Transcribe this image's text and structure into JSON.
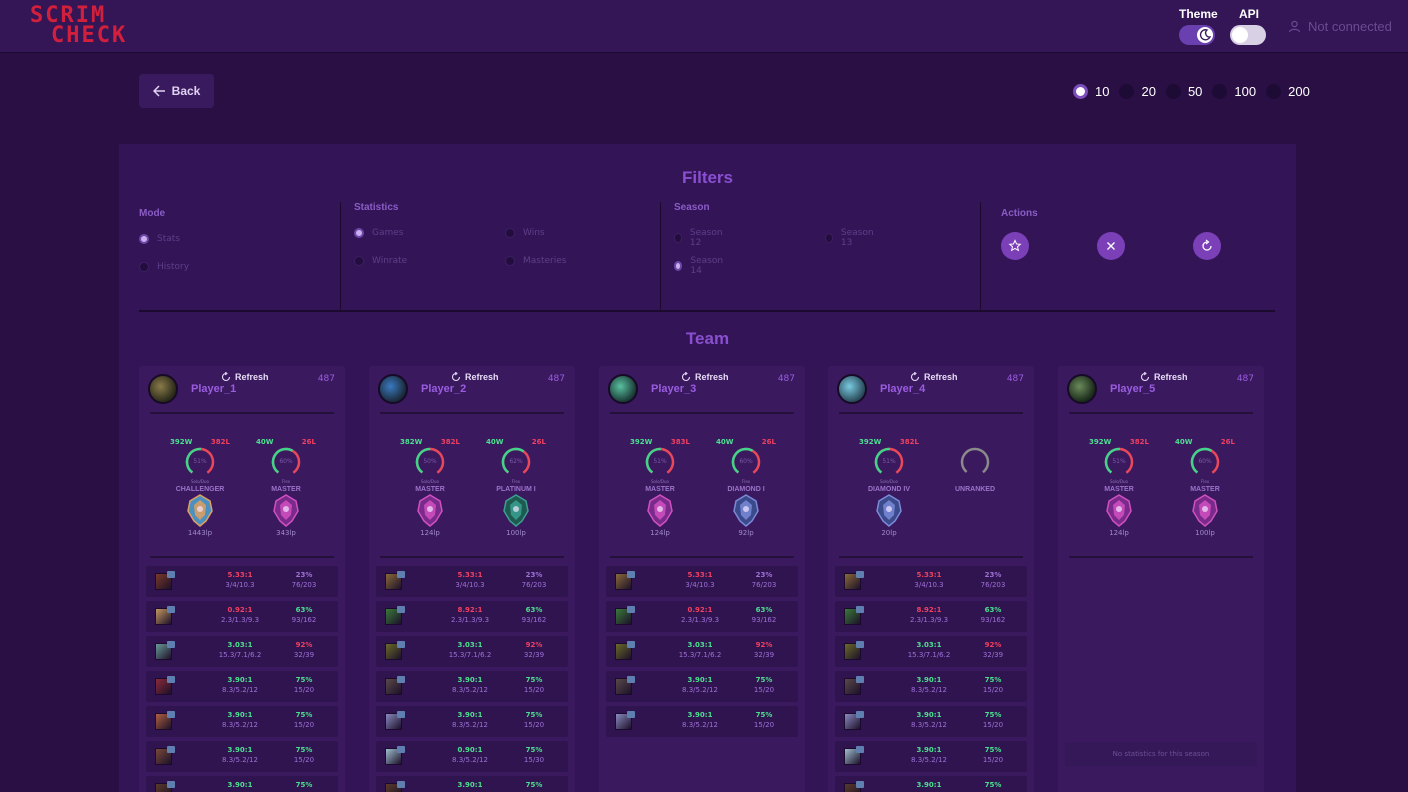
{
  "header": {
    "logo_line1": "SCRIM",
    "logo_line2": "CHECK",
    "theme_label": "Theme",
    "api_label": "API",
    "user_status": "Not connected"
  },
  "toolbar": {
    "back_label": "Back",
    "count_options": [
      {
        "label": "10",
        "selected": true
      },
      {
        "label": "20",
        "selected": false
      },
      {
        "label": "50",
        "selected": false
      },
      {
        "label": "100",
        "selected": false
      },
      {
        "label": "200",
        "selected": false
      }
    ]
  },
  "filters": {
    "title": "Filters",
    "mode": {
      "title": "Mode",
      "options": [
        {
          "label": "Stats",
          "selected": true
        },
        {
          "label": "History",
          "selected": false
        }
      ]
    },
    "statistics": {
      "title": "Statistics",
      "options": [
        {
          "label": "Games",
          "selected": true
        },
        {
          "label": "Wins",
          "selected": false
        },
        {
          "label": "Winrate",
          "selected": false
        },
        {
          "label": "Masteries",
          "selected": false
        }
      ]
    },
    "season": {
      "title": "Season",
      "options": [
        {
          "label": "Season 12",
          "selected": false
        },
        {
          "label": "Season 13",
          "selected": false
        },
        {
          "label": "Season 14",
          "selected": true
        }
      ]
    },
    "actions": {
      "title": "Actions",
      "buttons": [
        "star-icon",
        "close-icon",
        "refresh-icon"
      ]
    }
  },
  "team": {
    "title": "Team",
    "refresh_label": "Refresh",
    "no_stats_text": "No statistics for this season",
    "colors": {
      "win": "#4be08f",
      "loss": "#f04060",
      "accent": "#9a5de0"
    },
    "players": [
      {
        "name": "Player_1",
        "count": "487",
        "solo": {
          "wins": "392W",
          "losses": "382L",
          "winrate": "51%",
          "queue": "Solo/Duo",
          "tier": "CHALLENGER",
          "lp": "1443lp",
          "emblem": "challenger"
        },
        "flex": {
          "wins": "40W",
          "losses": "26L",
          "winrate": "60%",
          "queue": "Flex",
          "tier": "MASTER",
          "lp": "343lp",
          "emblem": "master"
        },
        "champions": [
          {
            "kda": "5.33:1",
            "kda_color": "#f04060",
            "line": "3/4/10.3",
            "winrate": "23%",
            "wr_color": "#9f71d8",
            "games": "76/203",
            "icon": "#7a3a2a"
          },
          {
            "kda": "0.92:1",
            "kda_color": "#f04060",
            "line": "2.3/1.3/9.3",
            "winrate": "63%",
            "wr_color": "#4be08f",
            "games": "93/162",
            "icon": "#c49860"
          },
          {
            "kda": "3.03:1",
            "kda_color": "#4be08f",
            "line": "15.3/7.1/6.2",
            "winrate": "92%",
            "wr_color": "#f04060",
            "games": "32/39",
            "icon": "#6a9a98"
          },
          {
            "kda": "3.90:1",
            "kda_color": "#4be08f",
            "line": "8.3/5.2/12",
            "winrate": "75%",
            "wr_color": "#4be08f",
            "games": "15/20",
            "icon": "#8a2a3a"
          },
          {
            "kda": "3.90:1",
            "kda_color": "#4be08f",
            "line": "8.3/5.2/12",
            "winrate": "75%",
            "wr_color": "#4be08f",
            "games": "15/20",
            "icon": "#b06040"
          },
          {
            "kda": "3.90:1",
            "kda_color": "#4be08f",
            "line": "8.3/5.2/12",
            "winrate": "75%",
            "wr_color": "#4be08f",
            "games": "15/20",
            "icon": "#7a4a3a"
          },
          {
            "kda": "3.90:1",
            "kda_color": "#4be08f",
            "line": "",
            "winrate": "75%",
            "wr_color": "#4be08f",
            "games": "",
            "icon": "#5a3a2a"
          }
        ]
      },
      {
        "name": "Player_2",
        "count": "487",
        "solo": {
          "wins": "382W",
          "losses": "382L",
          "winrate": "50%",
          "queue": "Solo/Duo",
          "tier": "MASTER",
          "lp": "124lp",
          "emblem": "master"
        },
        "flex": {
          "wins": "40W",
          "losses": "26L",
          "winrate": "62%",
          "queue": "Flex",
          "tier": "PLATINUM I",
          "lp": "100lp",
          "emblem": "platinum"
        },
        "champions": [
          {
            "kda": "5.33:1",
            "kda_color": "#f04060",
            "line": "3/4/10.3",
            "winrate": "23%",
            "wr_color": "#9f71d8",
            "games": "76/203",
            "icon": "#8a6a3a"
          },
          {
            "kda": "8.92:1",
            "kda_color": "#f04060",
            "line": "2.3/1.3/9.3",
            "winrate": "63%",
            "wr_color": "#4be08f",
            "games": "93/162",
            "icon": "#3a7a3a"
          },
          {
            "kda": "3.03:1",
            "kda_color": "#4be08f",
            "line": "15.3/7.1/6.2",
            "winrate": "92%",
            "wr_color": "#f04060",
            "games": "32/39",
            "icon": "#6a6a2a"
          },
          {
            "kda": "3.90:1",
            "kda_color": "#4be08f",
            "line": "8.3/5.2/12",
            "winrate": "75%",
            "wr_color": "#4be08f",
            "games": "15/20",
            "icon": "#5a4a4a"
          },
          {
            "kda": "3.90:1",
            "kda_color": "#4be08f",
            "line": "8.3/5.2/12",
            "winrate": "75%",
            "wr_color": "#4be08f",
            "games": "15/20",
            "icon": "#8a8ac0"
          },
          {
            "kda": "0.90:1",
            "kda_color": "#4be08f",
            "line": "8.3/5.2/12",
            "winrate": "75%",
            "wr_color": "#4be08f",
            "games": "15/30",
            "icon": "#a0c0d0"
          },
          {
            "kda": "3.90:1",
            "kda_color": "#4be08f",
            "line": "",
            "winrate": "75%",
            "wr_color": "#4be08f",
            "games": "",
            "icon": "#5a3a2a"
          }
        ]
      },
      {
        "name": "Player_3",
        "count": "487",
        "solo": {
          "wins": "392W",
          "losses": "383L",
          "winrate": "51%",
          "queue": "Solo/Duo",
          "tier": "MASTER",
          "lp": "124lp",
          "emblem": "master"
        },
        "flex": {
          "wins": "40W",
          "losses": "26L",
          "winrate": "60%",
          "queue": "Flex",
          "tier": "DIAMOND I",
          "lp": "92lp",
          "emblem": "diamond"
        },
        "champions": [
          {
            "kda": "5.33:1",
            "kda_color": "#f04060",
            "line": "3/4/10.3",
            "winrate": "23%",
            "wr_color": "#9f71d8",
            "games": "76/203",
            "icon": "#8a6a3a"
          },
          {
            "kda": "0.92:1",
            "kda_color": "#f04060",
            "line": "2.3/1.3/9.3",
            "winrate": "63%",
            "wr_color": "#4be08f",
            "games": "93/162",
            "icon": "#3a7a3a"
          },
          {
            "kda": "3.03:1",
            "kda_color": "#4be08f",
            "line": "15.3/7.1/6.2",
            "winrate": "92%",
            "wr_color": "#f04060",
            "games": "32/39",
            "icon": "#6a6a2a"
          },
          {
            "kda": "3.90:1",
            "kda_color": "#4be08f",
            "line": "8.3/5.2/12",
            "winrate": "75%",
            "wr_color": "#4be08f",
            "games": "15/20",
            "icon": "#5a4a4a"
          },
          {
            "kda": "3.90:1",
            "kda_color": "#4be08f",
            "line": "8.3/5.2/12",
            "winrate": "75%",
            "wr_color": "#4be08f",
            "games": "15/20",
            "icon": "#8a8ac0"
          }
        ]
      },
      {
        "name": "Player_4",
        "count": "487",
        "solo": {
          "wins": "392W",
          "losses": "382L",
          "winrate": "51%",
          "queue": "Solo/Duo",
          "tier": "DIAMOND IV",
          "lp": "20lp",
          "emblem": "diamond"
        },
        "flex": {
          "wins": "",
          "losses": "",
          "winrate": "",
          "queue": "",
          "tier": "UNRANKED",
          "lp": "",
          "emblem": "none"
        },
        "champions": [
          {
            "kda": "5.33:1",
            "kda_color": "#f04060",
            "line": "3/4/10.3",
            "winrate": "23%",
            "wr_color": "#9f71d8",
            "games": "76/203",
            "icon": "#8a6a3a"
          },
          {
            "kda": "8.92:1",
            "kda_color": "#f04060",
            "line": "2.3/1.3/9.3",
            "winrate": "63%",
            "wr_color": "#4be08f",
            "games": "93/162",
            "icon": "#3a7a3a"
          },
          {
            "kda": "3.03:1",
            "kda_color": "#4be08f",
            "line": "15.3/7.1/6.2",
            "winrate": "92%",
            "wr_color": "#f04060",
            "games": "32/39",
            "icon": "#6a6a2a"
          },
          {
            "kda": "3.90:1",
            "kda_color": "#4be08f",
            "line": "8.3/5.2/12",
            "winrate": "75%",
            "wr_color": "#4be08f",
            "games": "15/20",
            "icon": "#5a4a4a"
          },
          {
            "kda": "3.90:1",
            "kda_color": "#4be08f",
            "line": "8.3/5.2/12",
            "winrate": "75%",
            "wr_color": "#4be08f",
            "games": "15/20",
            "icon": "#8a8ac0"
          },
          {
            "kda": "3.90:1",
            "kda_color": "#4be08f",
            "line": "8.3/5.2/12",
            "winrate": "75%",
            "wr_color": "#4be08f",
            "games": "15/20",
            "icon": "#a0c0d0"
          },
          {
            "kda": "3.90:1",
            "kda_color": "#4be08f",
            "line": "",
            "winrate": "75%",
            "wr_color": "#4be08f",
            "games": "",
            "icon": "#5a3a2a"
          }
        ]
      },
      {
        "name": "Player_5",
        "count": "487",
        "solo": {
          "wins": "392W",
          "losses": "382L",
          "winrate": "51%",
          "queue": "Solo/Duo",
          "tier": "MASTER",
          "lp": "124lp",
          "emblem": "master"
        },
        "flex": {
          "wins": "40W",
          "losses": "26L",
          "winrate": "60%",
          "queue": "Flex",
          "tier": "MASTER",
          "lp": "100lp",
          "emblem": "master"
        },
        "champions": []
      }
    ]
  }
}
